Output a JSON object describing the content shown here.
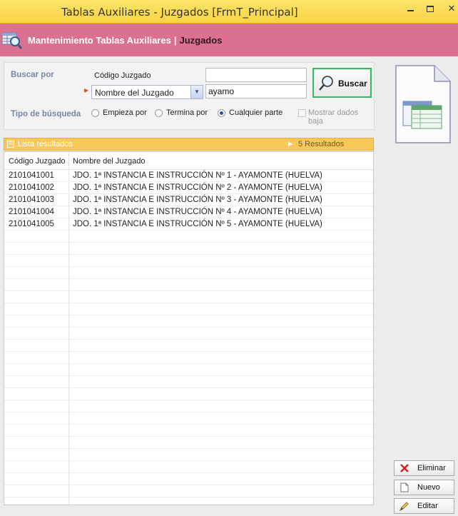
{
  "window": {
    "title": "Tablas Auxiliares - Juzgados [FrmT_Principal]",
    "controls": [
      "minimize",
      "maximize",
      "close"
    ]
  },
  "header": {
    "icon": "table-search-icon",
    "title": "Mantenimiento Tablas Auxiliares",
    "separator": "|",
    "subtitle": "Juzgados",
    "color": "#dc7090"
  },
  "search": {
    "buscar_por_label": "Buscar por",
    "codigo_label": "Código Juzgado",
    "codigo_value": "",
    "field_select_value": "Nombre del Juzgado",
    "nombre_value": "ayamo",
    "buscar_button": "Buscar",
    "tipo_label": "Tipo de búsqueda",
    "options": [
      {
        "label": "Empieza por",
        "selected": false
      },
      {
        "label": "Termina por",
        "selected": false
      },
      {
        "label": "Cualquier parte",
        "selected": true
      }
    ],
    "mostrar_baja_label": "Mostrar dados baja",
    "mostrar_baja_checked": false
  },
  "results": {
    "title": "Lista resultados",
    "count_label": "5 Resultados",
    "columns": [
      "Código Juzgado",
      "Nombre del Juzgado"
    ],
    "rows": [
      [
        "2101041001",
        "JDO. 1ª INSTANCIA E INSTRUCCIÓN Nº 1 - AYAMONTE (HUELVA)"
      ],
      [
        "2101041002",
        "JDO. 1ª INSTANCIA E INSTRUCCIÓN Nº 2 - AYAMONTE (HUELVA)"
      ],
      [
        "2101041003",
        "JDO. 1ª INSTANCIA E INSTRUCCIÓN Nº 3 - AYAMONTE (HUELVA)"
      ],
      [
        "2101041004",
        "JDO. 1ª INSTANCIA E INSTRUCCIÓN Nº 4 - AYAMONTE (HUELVA)"
      ],
      [
        "2101041005",
        "JDO. 1ª INSTANCIA E INSTRUCCIÓN Nº 5 - AYAMONTE (HUELVA)"
      ]
    ]
  },
  "actions": {
    "eliminar": "Eliminar",
    "nuevo": "Nuevo",
    "editar": "Editar"
  },
  "colors": {
    "titlebar": "#f7d443",
    "accent_green": "#3fb36a",
    "results_bar": "#f9c85a"
  }
}
